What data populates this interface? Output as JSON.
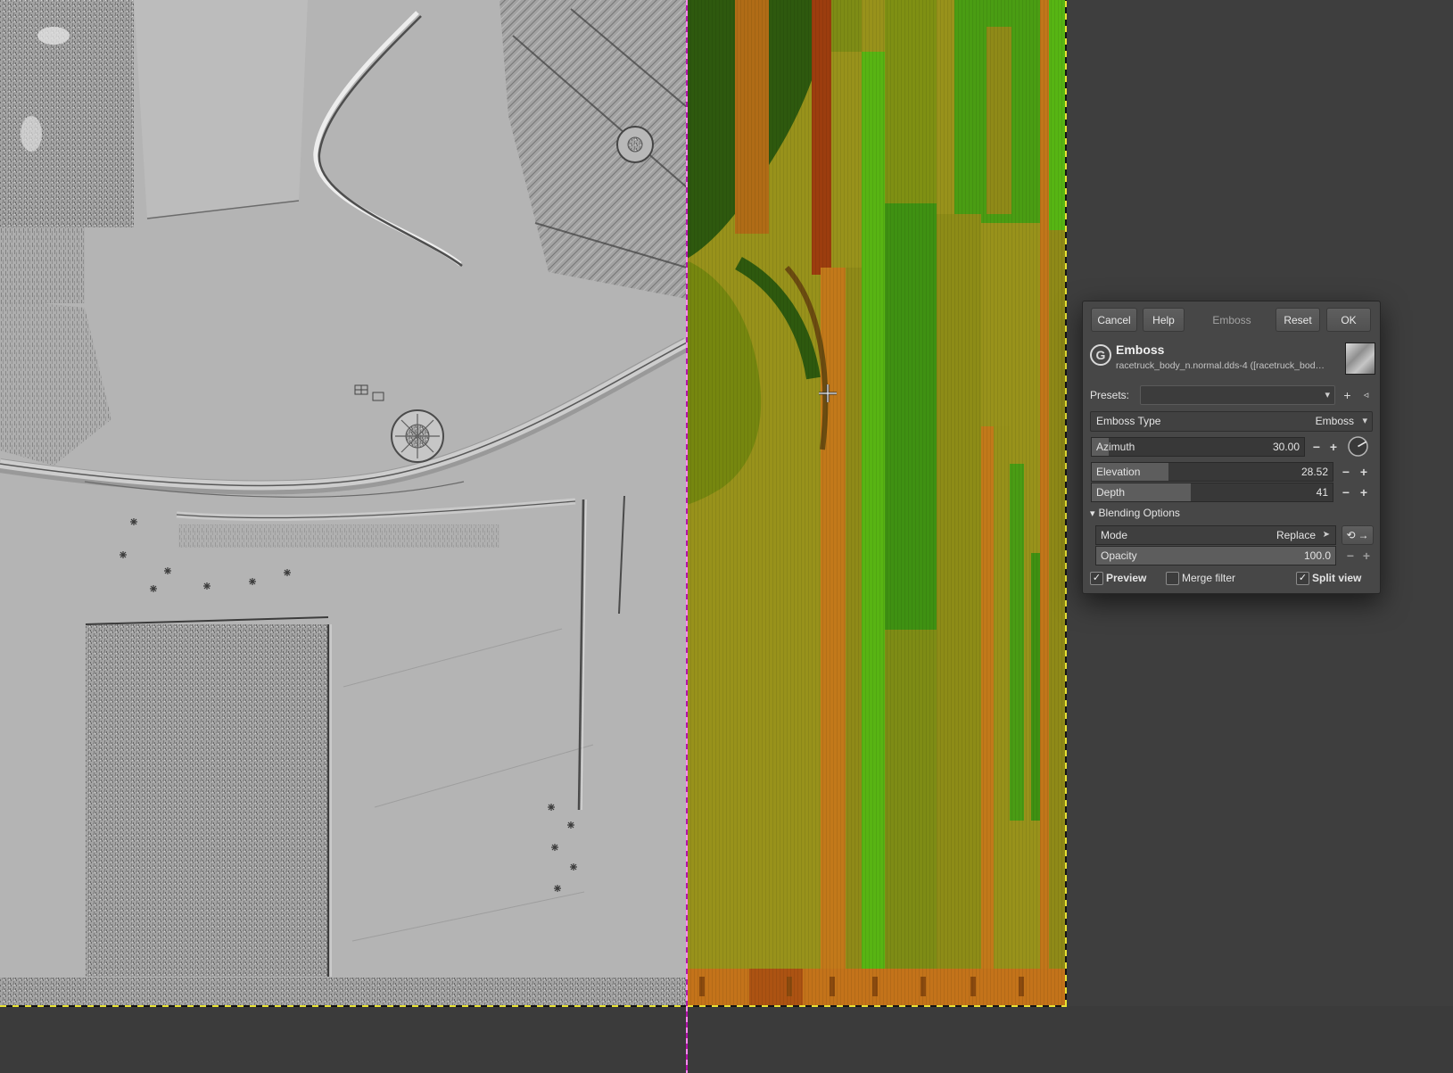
{
  "canvas": {
    "split_line_color": "#ff7cf3",
    "boundary_color": "#e8e232",
    "left_pane_desc": "emboss-preview-grayscale",
    "right_pane_desc": "original-normal-map",
    "normal_map_colors": [
      "#98921b",
      "#58b413",
      "#3f9112",
      "#c2791a",
      "#9c3d0e",
      "#2e590e"
    ]
  },
  "dialog": {
    "buttons": {
      "cancel": "Cancel",
      "help": "Help",
      "filter": "Emboss",
      "reset": "Reset",
      "ok": "OK"
    },
    "title": "Emboss",
    "subtitle": "racetruck_body_n.normal.dds-4 ([racetruck_bod…",
    "presets_label": "Presets:",
    "preset_value": "",
    "emboss_type_label": "Emboss Type",
    "emboss_type_value": "Emboss",
    "azimuth_label": "Azimuth",
    "azimuth_value": "30.00",
    "elevation_label": "Elevation",
    "elevation_value": "28.52",
    "depth_label": "Depth",
    "depth_value": "41",
    "blending_header": "Blending Options",
    "mode_label": "Mode",
    "mode_value": "Replace",
    "opacity_label": "Opacity",
    "opacity_value": "100.0",
    "preview_label": "Preview",
    "merge_label": "Merge filter",
    "split_label": "Split view"
  },
  "icons": {
    "logo": "G",
    "chevron_down": "▾",
    "plus": "+",
    "minus": "−",
    "preset_add": "+",
    "preset_menu": "◃",
    "expander": "▾",
    "check": "✓",
    "mode_arrow": "➤",
    "mode_reset": "⟲",
    "mode_menu": "→"
  }
}
